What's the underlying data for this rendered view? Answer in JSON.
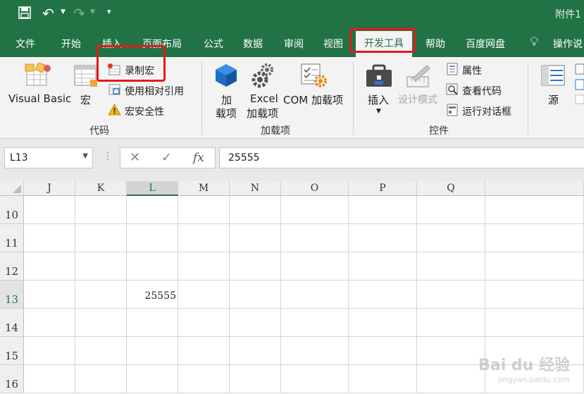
{
  "titlebar": {
    "filename": "附件1"
  },
  "menu": {
    "tabs": [
      "文件",
      "开始",
      "插入",
      "页面布局",
      "公式",
      "数据",
      "审阅",
      "视图",
      "开发工具",
      "帮助",
      "百度网盘",
      "操作说"
    ],
    "active": "开发工具"
  },
  "ribbon": {
    "code_group": {
      "label": "代码",
      "visual_basic": "Visual Basic",
      "macros": "宏",
      "record_macro": "录制宏",
      "use_relative": "使用相对引用",
      "macro_security": "宏安全性"
    },
    "addins_group": {
      "label": "加载项",
      "addins_1": "加",
      "addins_2": "载项",
      "excel_addins_1": "Excel",
      "excel_addins_2": "加载项",
      "com_addins": "COM 加载项"
    },
    "controls_group": {
      "label": "控件",
      "insert": "插入",
      "design_mode": "设计模式",
      "properties": "属性",
      "view_code": "查看代码",
      "run_dialog": "运行对话框"
    },
    "xml_group": {
      "source": "源"
    }
  },
  "formula_bar": {
    "name_box": "L13",
    "cancel_icon": "✕",
    "enter_icon": "✓",
    "fx_icon": "fx",
    "value": "25555"
  },
  "sheet": {
    "columns": [
      "J",
      "K",
      "L",
      "M",
      "N",
      "O",
      "P",
      "Q"
    ],
    "selected_column": "L",
    "rows": [
      "10",
      "11",
      "12",
      "13",
      "14",
      "15",
      "16"
    ],
    "selected_row": "13",
    "cell_value": "25555"
  },
  "watermark": {
    "brand": "Bai du 经验",
    "url": "jingyan.baidu.com"
  },
  "colors": {
    "excel_green": "#217346",
    "highlight_red": "#e8191a"
  }
}
